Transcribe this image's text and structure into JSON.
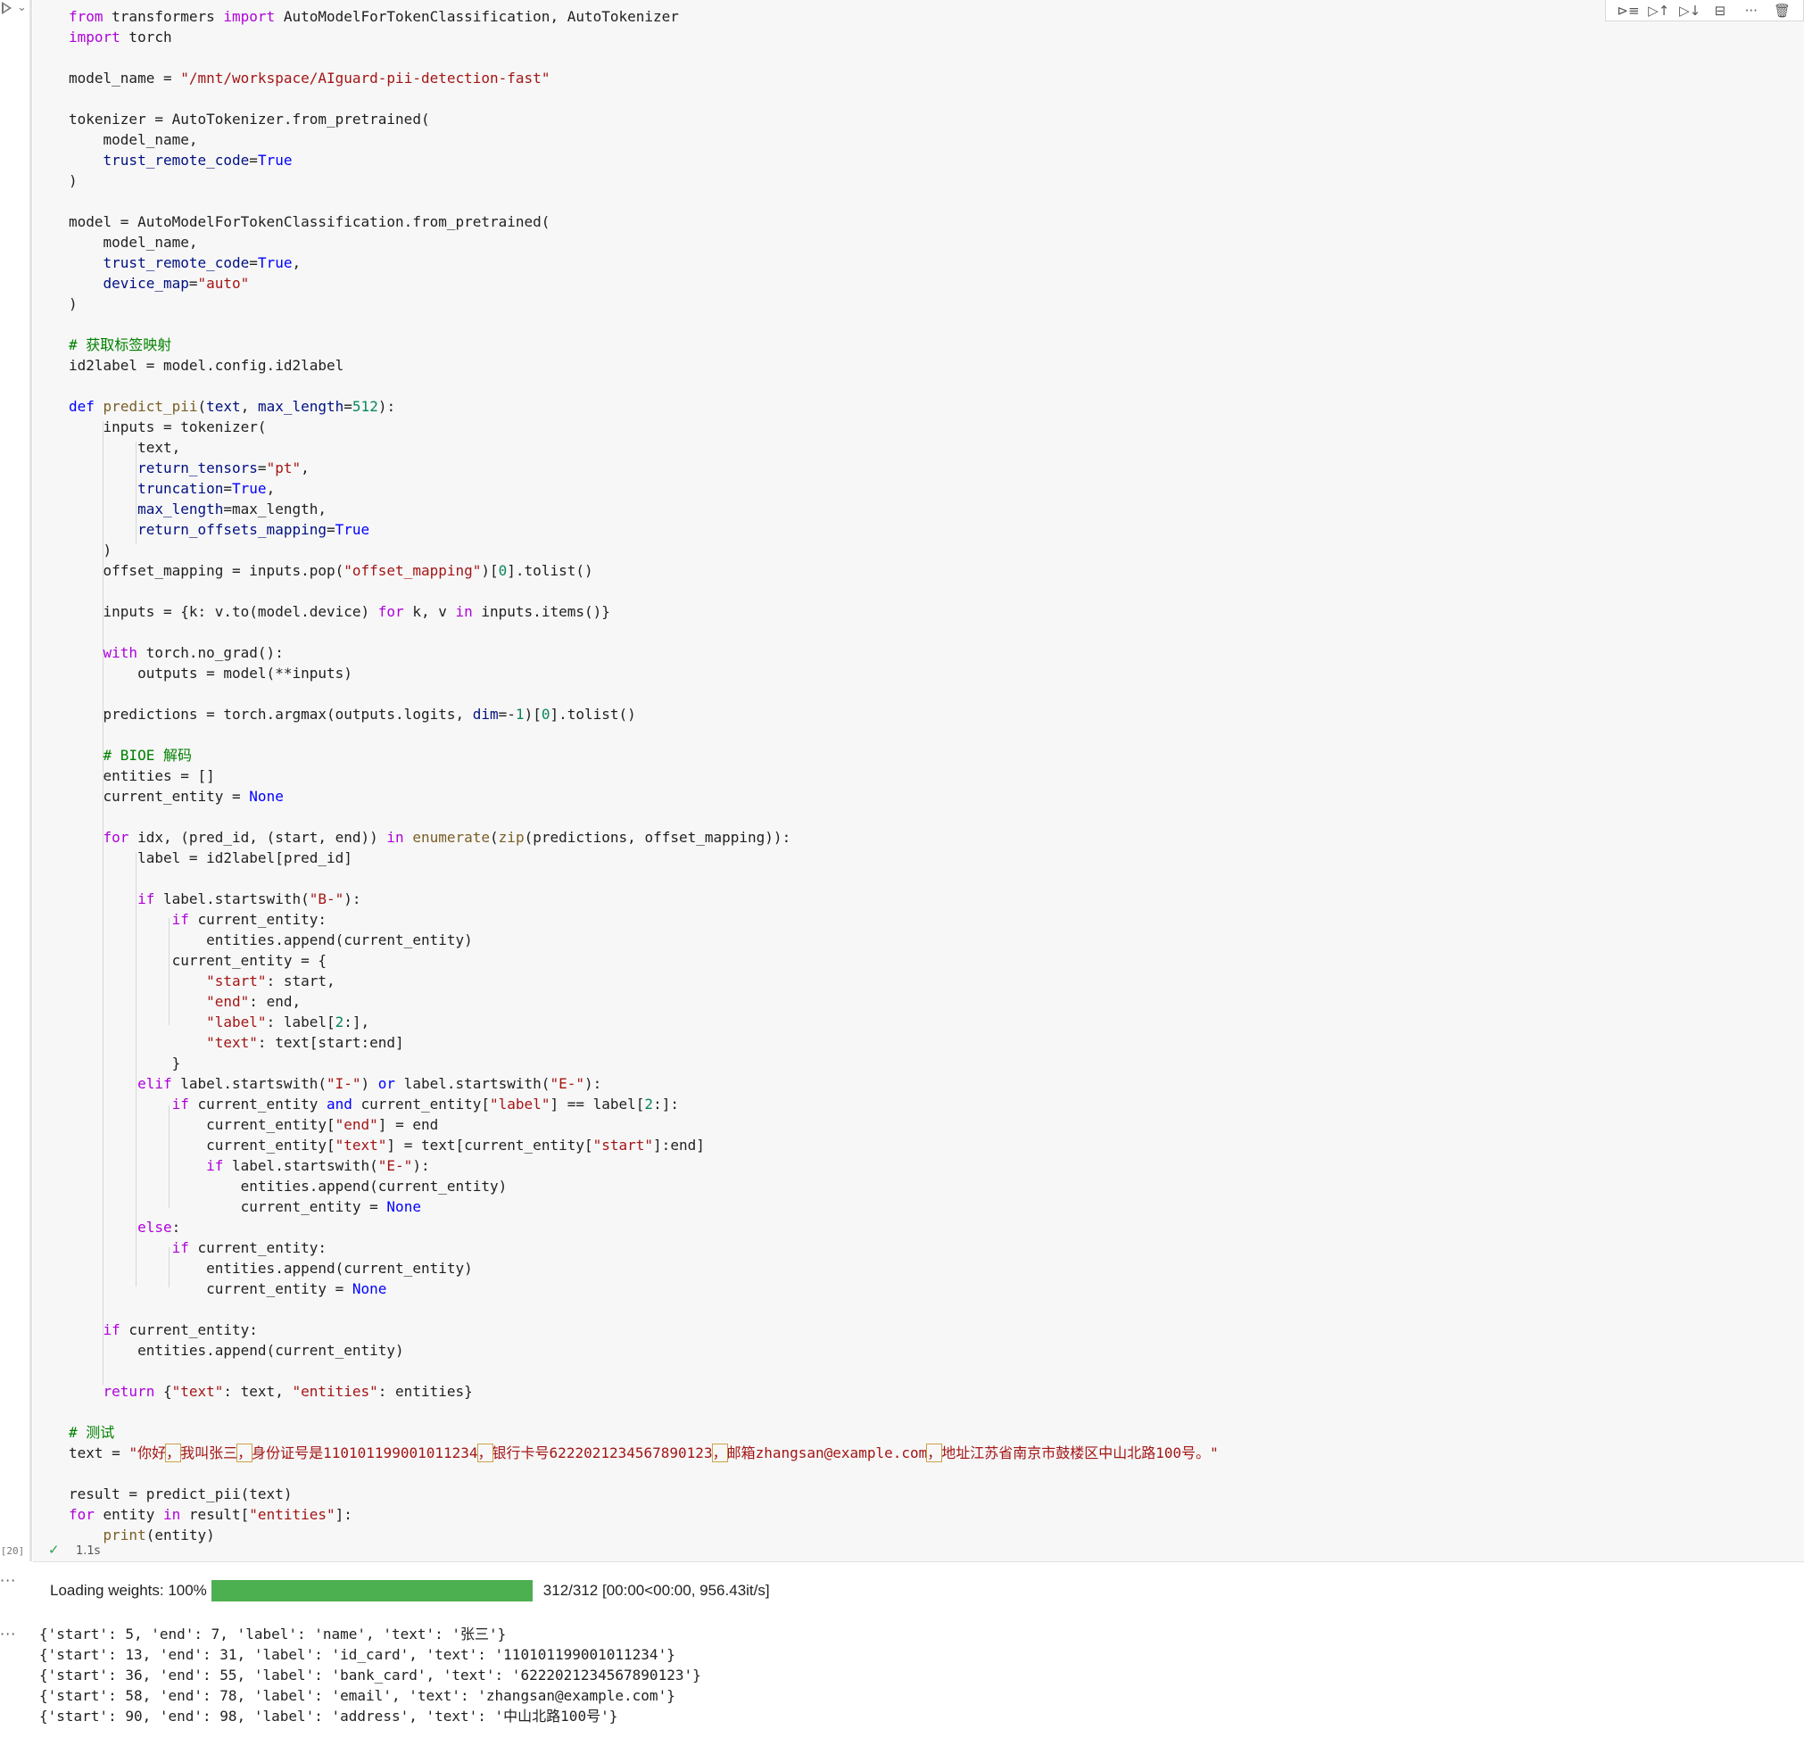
{
  "cell": {
    "execution_count": "[20]",
    "duration": "1.1s",
    "code_lines": [
      "from transformers import AutoModelForTokenClassification, AutoTokenizer",
      "import torch",
      "",
      "model_name = \"/mnt/workspace/AIguard-pii-detection-fast\"",
      "",
      "tokenizer = AutoTokenizer.from_pretrained(",
      "    model_name,",
      "    trust_remote_code=True",
      ")",
      "",
      "model = AutoModelForTokenClassification.from_pretrained(",
      "    model_name,",
      "    trust_remote_code=True,",
      "    device_map=\"auto\"",
      ")",
      "",
      "# 获取标签映射",
      "id2label = model.config.id2label",
      "",
      "def predict_pii(text, max_length=512):",
      "    inputs = tokenizer(",
      "        text,",
      "        return_tensors=\"pt\",",
      "        truncation=True,",
      "        max_length=max_length,",
      "        return_offsets_mapping=True",
      "    )",
      "    offset_mapping = inputs.pop(\"offset_mapping\")[0].tolist()",
      "",
      "    inputs = {k: v.to(model.device) for k, v in inputs.items()}",
      "",
      "    with torch.no_grad():",
      "        outputs = model(**inputs)",
      "",
      "    predictions = torch.argmax(outputs.logits, dim=-1)[0].tolist()",
      "",
      "    # BIOE 解码",
      "    entities = []",
      "    current_entity = None",
      "",
      "    for idx, (pred_id, (start, end)) in enumerate(zip(predictions, offset_mapping)):",
      "        label = id2label[pred_id]",
      "",
      "        if label.startswith(\"B-\"):",
      "            if current_entity:",
      "                entities.append(current_entity)",
      "            current_entity = {",
      "                \"start\": start,",
      "                \"end\": end,",
      "                \"label\": label[2:],",
      "                \"text\": text[start:end]",
      "            }",
      "        elif label.startswith(\"I-\") or label.startswith(\"E-\"):",
      "            if current_entity and current_entity[\"label\"] == label[2:]:",
      "                current_entity[\"end\"] = end",
      "                current_entity[\"text\"] = text[current_entity[\"start\"]:end]",
      "                if label.startswith(\"E-\"):",
      "                    entities.append(current_entity)",
      "                    current_entity = None",
      "        else:",
      "            if current_entity:",
      "                entities.append(current_entity)",
      "                current_entity = None",
      "",
      "    if current_entity:",
      "        entities.append(current_entity)",
      "",
      "    return {\"text\": text, \"entities\": entities}",
      "",
      "# 测试",
      "text = \"你好，我叫张三，身份证号是110101199001011234，银行卡号6222021234567890123，邮箱zhangsan@example.com，地址江苏省南京市鼓楼区中山北路100号。\"",
      "",
      "result = predict_pii(text)",
      "for entity in result[\"entities\"]:",
      "    print(entity)"
    ]
  },
  "output": {
    "progress": {
      "label": "Loading weights: 100%",
      "fraction": 1.0,
      "status": "312/312 [00:00<00:00,  956.43it/s]",
      "color": "#4caf50"
    },
    "lines": [
      "{'start': 5, 'end': 7, 'label': 'name', 'text': '张三'}",
      "{'start': 13, 'end': 31, 'label': 'id_card', 'text': '110101199001011234'}",
      "{'start': 36, 'end': 55, 'label': 'bank_card', 'text': '6222021234567890123'}",
      "{'start': 58, 'end': 78, 'label': 'email', 'text': 'zhangsan@example.com'}",
      "{'start': 90, 'end': 98, 'label': 'address', 'text': '中山北路100号'}"
    ]
  },
  "icons": [
    "run-cell-icon",
    "collapse-chevron-icon",
    "run-by-line-icon",
    "execute-above-icon",
    "execute-below-icon",
    "split-cell-icon",
    "more-actions-icon",
    "delete-cell-icon",
    "success-check-icon"
  ]
}
